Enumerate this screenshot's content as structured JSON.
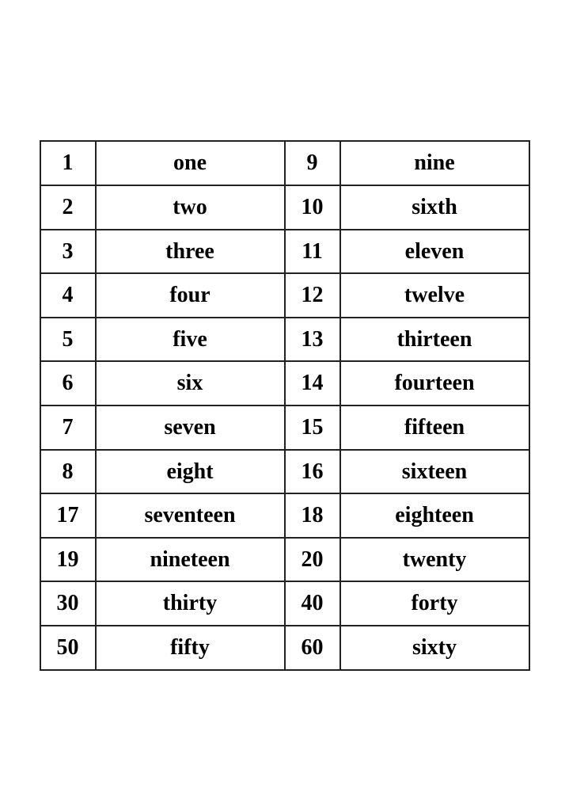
{
  "table": {
    "rows": [
      {
        "col1_num": "1",
        "col1_word": "one",
        "col2_num": "9",
        "col2_word": "nine"
      },
      {
        "col1_num": "2",
        "col1_word": "two",
        "col2_num": "10",
        "col2_word": "sixth"
      },
      {
        "col1_num": "3",
        "col1_word": "three",
        "col2_num": "11",
        "col2_word": "eleven"
      },
      {
        "col1_num": "4",
        "col1_word": "four",
        "col2_num": "12",
        "col2_word": "twelve"
      },
      {
        "col1_num": "5",
        "col1_word": "five",
        "col2_num": "13",
        "col2_word": "thirteen"
      },
      {
        "col1_num": "6",
        "col1_word": "six",
        "col2_num": "14",
        "col2_word": "fourteen"
      },
      {
        "col1_num": "7",
        "col1_word": "seven",
        "col2_num": "15",
        "col2_word": "fifteen"
      },
      {
        "col1_num": "8",
        "col1_word": "eight",
        "col2_num": "16",
        "col2_word": "sixteen"
      },
      {
        "col1_num": "17",
        "col1_word": "seventeen",
        "col2_num": "18",
        "col2_word": "eighteen"
      },
      {
        "col1_num": "19",
        "col1_word": "nineteen",
        "col2_num": "20",
        "col2_word": "twenty"
      },
      {
        "col1_num": "30",
        "col1_word": "thirty",
        "col2_num": "40",
        "col2_word": "forty"
      },
      {
        "col1_num": "50",
        "col1_word": "fifty",
        "col2_num": "60",
        "col2_word": "sixty"
      }
    ]
  }
}
